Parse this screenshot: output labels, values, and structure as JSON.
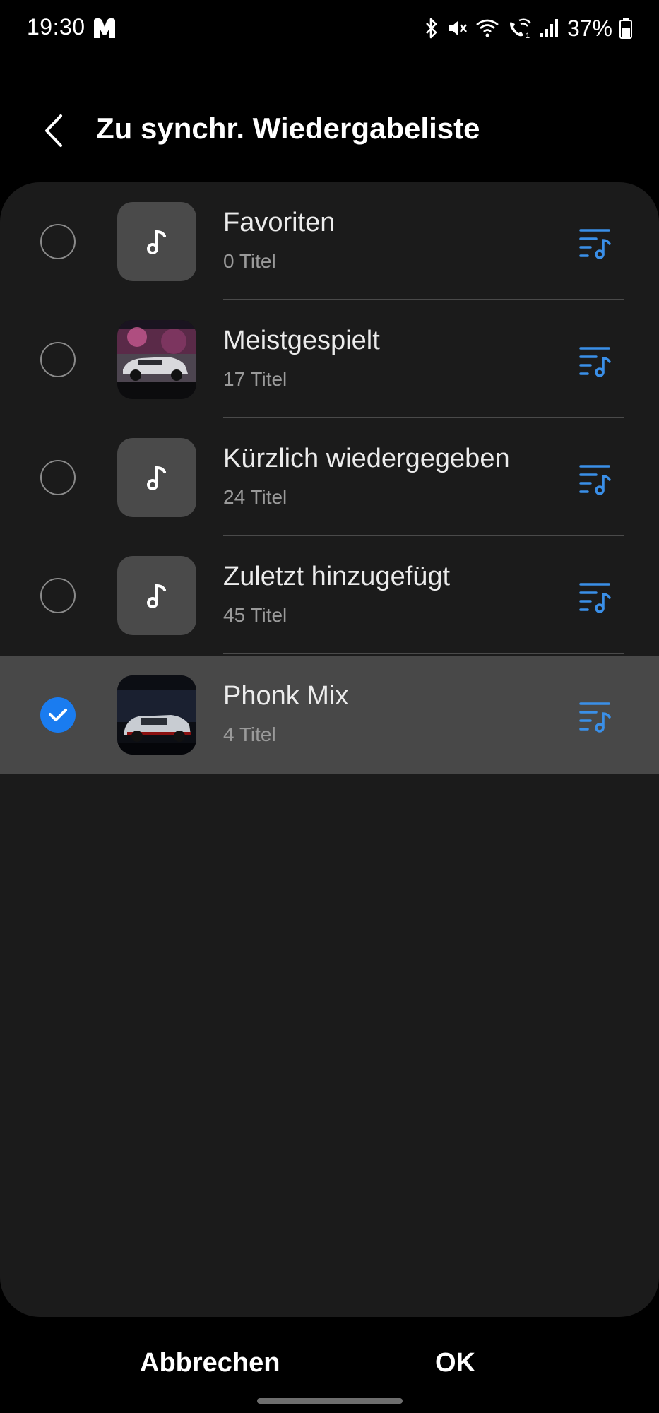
{
  "status_bar": {
    "time": "19:30",
    "battery": "37%",
    "icons": [
      "m-app-icon",
      "bluetooth-icon",
      "mute-icon",
      "wifi-icon",
      "wifi-call-icon",
      "signal-icon",
      "battery-icon"
    ]
  },
  "appbar": {
    "back_icon": "chevron-left-icon",
    "title": "Zu synchr. Wiedergabeliste"
  },
  "playlists": [
    {
      "title": "Favoriten",
      "subtitle": "0 Titel",
      "thumb": "music-note",
      "checked": false
    },
    {
      "title": "Meistgespielt",
      "subtitle": "17 Titel",
      "thumb": "car-image-pink",
      "checked": false
    },
    {
      "title": "Kürzlich wiedergegeben",
      "subtitle": "24 Titel",
      "thumb": "music-note",
      "checked": false
    },
    {
      "title": "Zuletzt hinzugefügt",
      "subtitle": "45 Titel",
      "thumb": "music-note",
      "checked": false
    },
    {
      "title": "Phonk Mix",
      "subtitle": "4 Titel",
      "thumb": "car-image-dark",
      "checked": true
    }
  ],
  "buttons": {
    "cancel": "Abbrechen",
    "ok": "OK"
  },
  "colors": {
    "accent": "#1a7cf0",
    "panel": "#1b1b1b",
    "selected_row": "#484848",
    "playlist_icon": "#3a8fe8"
  }
}
